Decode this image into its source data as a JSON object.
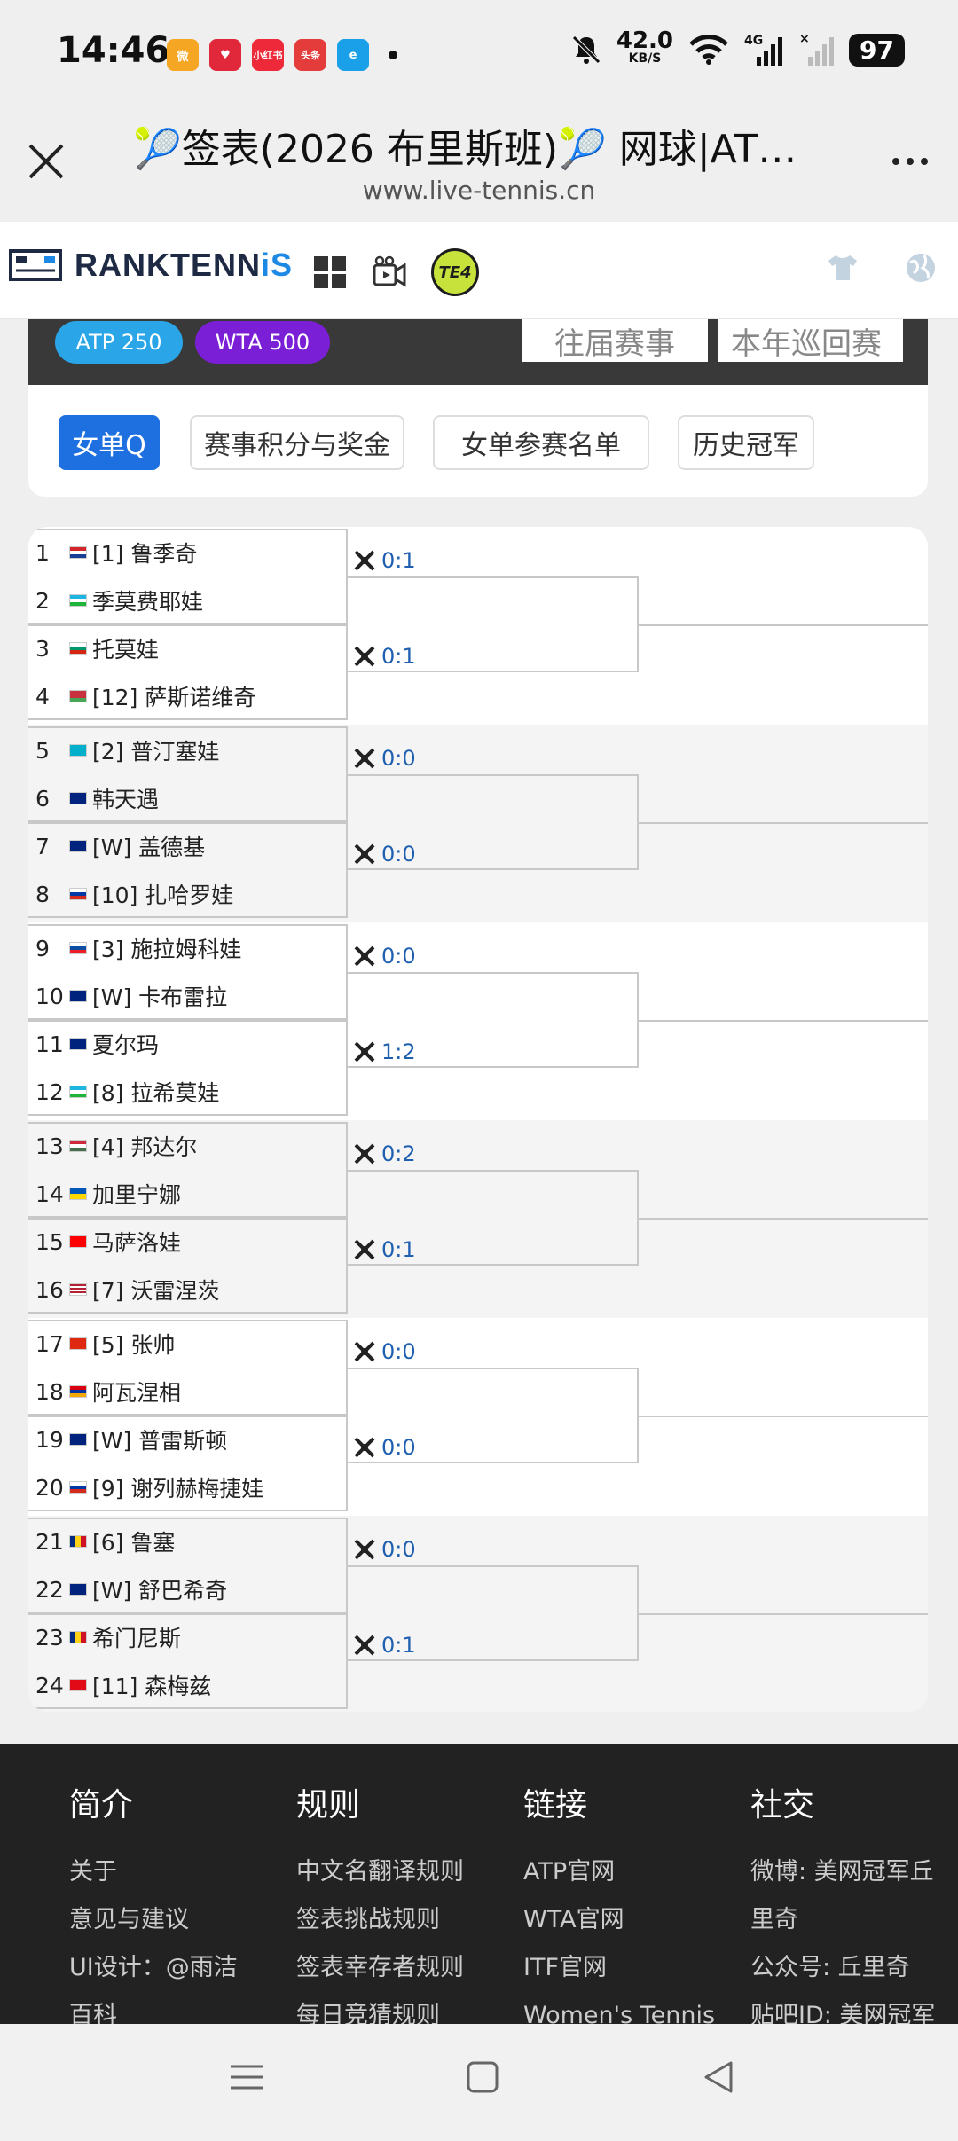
{
  "status": {
    "time": "14:46",
    "apps": [
      {
        "icon": "weibo-icon",
        "color": "#f5a623",
        "label": "微"
      },
      {
        "icon": "heart-app-icon",
        "color": "#e0283a",
        "label": "♥"
      },
      {
        "icon": "xiaohongshu-icon",
        "color": "#ee2a3a",
        "label": "小红书"
      },
      {
        "icon": "toutiao-icon",
        "color": "#e43b3b",
        "label": "头条"
      },
      {
        "icon": "browser-app-icon",
        "color": "#1aa0e8",
        "label": "e"
      }
    ],
    "net_speed_value": "42.0",
    "net_speed_unit": "KB/S",
    "battery": "97"
  },
  "browser": {
    "title": "🎾签表(2026 布里斯班)🎾 网球|ATP...",
    "url": "www.live-tennis.cn"
  },
  "site": {
    "logo_main": "RANKTENN",
    "logo_accent": "iS",
    "badge": "TE4"
  },
  "banner": {
    "pills": [
      "ATP 250",
      "WTA 500"
    ],
    "tabs": [
      "往届赛事",
      "本年巡回赛"
    ]
  },
  "subtabs": [
    "女单Q",
    "赛事积分与奖金",
    "女单参赛名单",
    "历史冠军"
  ],
  "colors": {
    "accent": "#1e6fe0",
    "atp": "#2aa6e8",
    "wta": "#7b1fd6",
    "score": "#1f5fb0"
  },
  "draw": [
    {
      "num": "1",
      "flag": "croatia",
      "name": "[1] 鲁季奇"
    },
    {
      "num": "2",
      "flag": "uzbekistan",
      "name": "季莫费耶娃"
    },
    {
      "num": "3",
      "flag": "bulgaria",
      "name": "托莫娃"
    },
    {
      "num": "4",
      "flag": "belarus",
      "name": "[12] 萨斯诺维奇"
    },
    {
      "num": "5",
      "flag": "kazakhstan",
      "name": "[2] 普汀塞娃"
    },
    {
      "num": "6",
      "flag": "australia",
      "name": "韩天遇"
    },
    {
      "num": "7",
      "flag": "australia",
      "name": "[W] 盖德基"
    },
    {
      "num": "8",
      "flag": "russia",
      "name": "[10] 扎哈罗娃"
    },
    {
      "num": "9",
      "flag": "slovakia",
      "name": "[3] 施拉姆科娃"
    },
    {
      "num": "10",
      "flag": "australia",
      "name": "[W] 卡布雷拉"
    },
    {
      "num": "11",
      "flag": "australia",
      "name": "夏尔玛"
    },
    {
      "num": "12",
      "flag": "uzbekistan",
      "name": "[8] 拉希莫娃"
    },
    {
      "num": "13",
      "flag": "hungary",
      "name": "[4] 邦达尔"
    },
    {
      "num": "14",
      "flag": "ukraine",
      "name": "加里宁娜"
    },
    {
      "num": "15",
      "flag": "switzerland",
      "name": "马萨洛娃"
    },
    {
      "num": "16",
      "flag": "usa",
      "name": "[7] 沃雷涅茨"
    },
    {
      "num": "17",
      "flag": "china",
      "name": "[5] 张帅"
    },
    {
      "num": "18",
      "flag": "armenia",
      "name": "阿瓦涅相"
    },
    {
      "num": "19",
      "flag": "australia",
      "name": "[W] 普雷斯顿"
    },
    {
      "num": "20",
      "flag": "russia",
      "name": "[9] 谢列赫梅捷娃"
    },
    {
      "num": "21",
      "flag": "romania",
      "name": "[6] 鲁塞"
    },
    {
      "num": "22",
      "flag": "australia",
      "name": "[W] 舒巴希奇"
    },
    {
      "num": "23",
      "flag": "romania",
      "name": "希门尼斯"
    },
    {
      "num": "24",
      "flag": "turkey",
      "name": "[11] 森梅兹"
    }
  ],
  "scores": [
    "0:1",
    "0:1",
    "0:0",
    "0:0",
    "0:0",
    "1:2",
    "0:2",
    "0:1",
    "0:0",
    "0:0",
    "0:0",
    "0:1"
  ],
  "footer": {
    "columns": [
      {
        "title": "简介",
        "links": [
          "关于",
          "意见与建议",
          "UI设计：@雨洁",
          "百科"
        ]
      },
      {
        "title": "规则",
        "links": [
          "中文名翻译规则",
          "签表挑战规则",
          "签表幸存者规则",
          "每日竞猜规则"
        ]
      },
      {
        "title": "链接",
        "links": [
          "ATP官网",
          "WTA官网",
          "ITF官网",
          "Women's Tennis"
        ]
      },
      {
        "title": "社交",
        "links": [
          "微博: 美网冠军丘",
          "里奇",
          "公众号: 丘里奇",
          "贴吧ID: 美网冠军"
        ]
      }
    ]
  }
}
